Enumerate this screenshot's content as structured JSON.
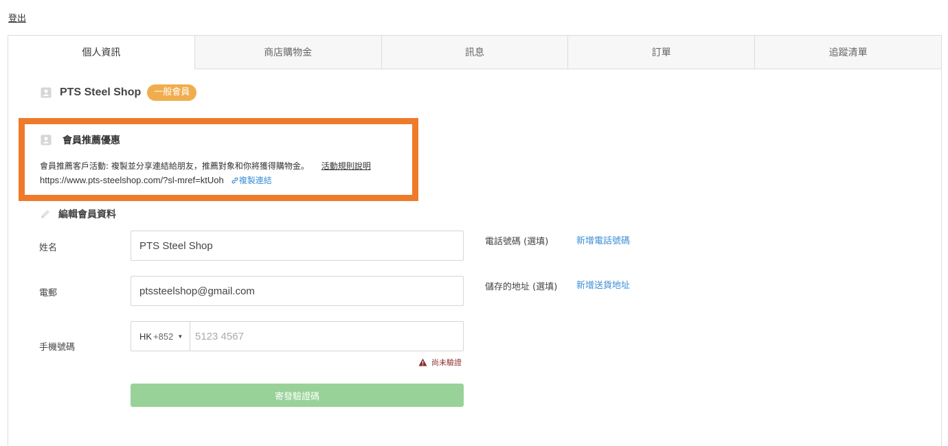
{
  "header": {
    "logout_label": "登出"
  },
  "tabs": [
    {
      "label": "個人資訊",
      "active": true
    },
    {
      "label": "商店購物金",
      "active": false
    },
    {
      "label": "訊息",
      "active": false
    },
    {
      "label": "訂單",
      "active": false
    },
    {
      "label": "追蹤清單",
      "active": false
    }
  ],
  "profile": {
    "name": "PTS Steel Shop",
    "badge": "一般會員"
  },
  "referral": {
    "title": "會員推薦優惠",
    "description": "會員推薦客戶活動: 複製並分享連結給朋友，推薦對象和你將獲得購物金。",
    "rules_link": "活動規則說明",
    "url": "https://www.pts-steelshop.com/?sl-mref=ktUoh",
    "copy_label": "複製連結"
  },
  "edit": {
    "title": "編輯會員資料",
    "name_label": "姓名",
    "name_value": "PTS Steel Shop",
    "email_label": "電郵",
    "email_value": "ptssteelshop@gmail.com",
    "mobile_label": "手機號碼",
    "country_code": "HK",
    "dial_code": "+852",
    "mobile_placeholder": "5123 4567",
    "unverified_label": "尚未驗證",
    "send_button": "寄發驗證碼"
  },
  "side": {
    "phone_label": "電話號碼 (選填)",
    "phone_link": "新增電話號碼",
    "address_label": "儲存的地址 (選填)",
    "address_link": "新增送貨地址"
  },
  "colors": {
    "highlight_border": "#ef7a2a",
    "badge": "#f0ad4e",
    "link": "#3b8fd6",
    "send_button": "#98d298",
    "warning": "#8a2d2d"
  }
}
